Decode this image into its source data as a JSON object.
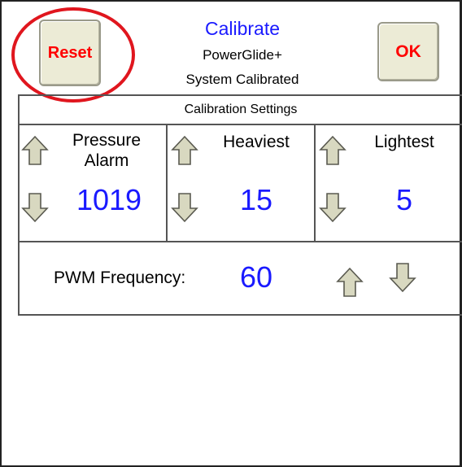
{
  "header": {
    "title": "Calibrate",
    "subtitle": "PowerGlide+",
    "status": "System Calibrated",
    "reset_label": "Reset",
    "ok_label": "OK"
  },
  "settings": {
    "section_title": "Calibration Settings",
    "pressure_alarm": {
      "label_line1": "Pressure",
      "label_line2": "Alarm",
      "value": "1019"
    },
    "heaviest": {
      "label": "Heaviest",
      "value": "15"
    },
    "lightest": {
      "label": "Lightest",
      "value": "5"
    },
    "pwm": {
      "label": "PWM Frequency:",
      "value": "60"
    }
  },
  "colors": {
    "title": "#1a1aff",
    "value": "#1a1aff",
    "button_text": "#ff0000",
    "highlight": "#e0161e",
    "arrow_fill": "#d8d8c0"
  },
  "icons": [
    "up-arrow-icon",
    "down-arrow-icon"
  ]
}
